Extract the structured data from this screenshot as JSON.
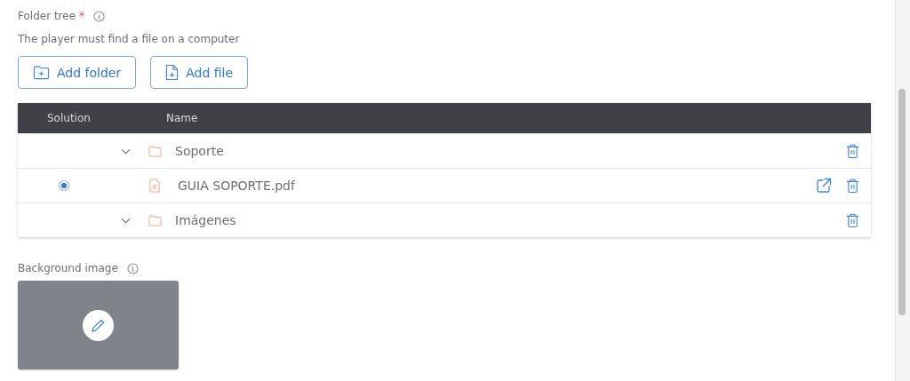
{
  "folder_tree": {
    "label": "Folder tree",
    "required_mark": "*",
    "description": "The player must find a file on a computer",
    "buttons": [
      {
        "kind": "folder",
        "label": "Add folder"
      },
      {
        "kind": "file",
        "label": "Add file"
      }
    ]
  },
  "table": {
    "columns": [
      "Solution",
      "Name"
    ],
    "rows": [
      {
        "kind": "folder",
        "name": "Soporte",
        "expanded": true
      },
      {
        "kind": "file",
        "name": "GUIA SOPORTE.pdf",
        "selected": true
      },
      {
        "kind": "folder",
        "name": "Imágenes",
        "expanded": true
      }
    ]
  },
  "background_image": {
    "label": "Background image"
  }
}
